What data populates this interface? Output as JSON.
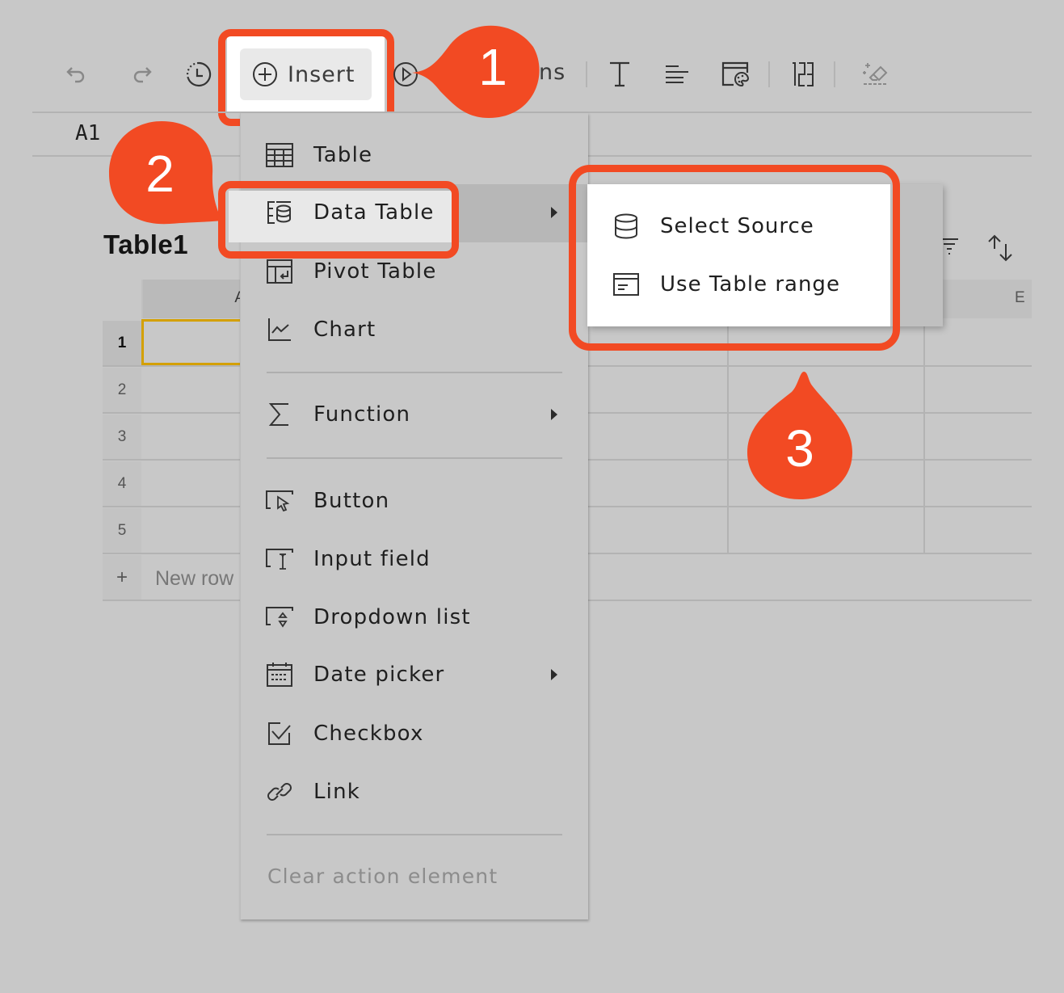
{
  "toolbar": {
    "undo_icon": "undo-icon",
    "redo_icon": "redo-icon",
    "history_icon": "history-icon",
    "insert_label": "Insert",
    "actions_label": "Actions",
    "actions_visible_text": "ns",
    "text_icon": "text-format-icon",
    "align_icon": "align-left-icon",
    "style_icon": "cell-style-palette-icon",
    "number_format_icon": "number-format-123-icon",
    "clear_format_icon": "clear-format-eraser-icon"
  },
  "formula_bar": {
    "cell_reference": "A1"
  },
  "sheet": {
    "table_title": "Table1",
    "columns": [
      "A",
      "E"
    ],
    "rows": [
      "1",
      "2",
      "3",
      "4",
      "5"
    ],
    "selected_cell": "A1",
    "new_row_label": "New row",
    "new_row_icon": "+",
    "selection_color": "#d4a000"
  },
  "insert_menu": {
    "items": [
      {
        "label": "Table",
        "icon": "table-grid-icon",
        "submenu": false
      },
      {
        "label": "Data Table",
        "icon": "data-table-icon",
        "submenu": true,
        "highlighted": true
      },
      {
        "label": "Pivot Table",
        "icon": "pivot-table-icon",
        "submenu": false
      },
      {
        "label": "Chart",
        "icon": "line-chart-icon",
        "submenu": false
      },
      {
        "label": "Function",
        "icon": "sigma-icon",
        "submenu": true
      },
      {
        "label": "Button",
        "icon": "button-cursor-icon",
        "submenu": false
      },
      {
        "label": "Input field",
        "icon": "input-field-icon",
        "submenu": false
      },
      {
        "label": "Dropdown list",
        "icon": "dropdown-list-icon",
        "submenu": false
      },
      {
        "label": "Date picker",
        "icon": "calendar-icon",
        "submenu": true
      },
      {
        "label": "Checkbox",
        "icon": "checkbox-icon",
        "submenu": false
      },
      {
        "label": "Link",
        "icon": "link-icon",
        "submenu": false
      }
    ],
    "clear_label": "Clear action element"
  },
  "data_table_submenu": {
    "items": [
      {
        "label": "Select Source",
        "icon": "database-icon"
      },
      {
        "label": "Use Table range",
        "icon": "table-range-icon"
      }
    ]
  },
  "annotations": {
    "color": "#f24a23",
    "steps": [
      "1",
      "2",
      "3"
    ]
  }
}
